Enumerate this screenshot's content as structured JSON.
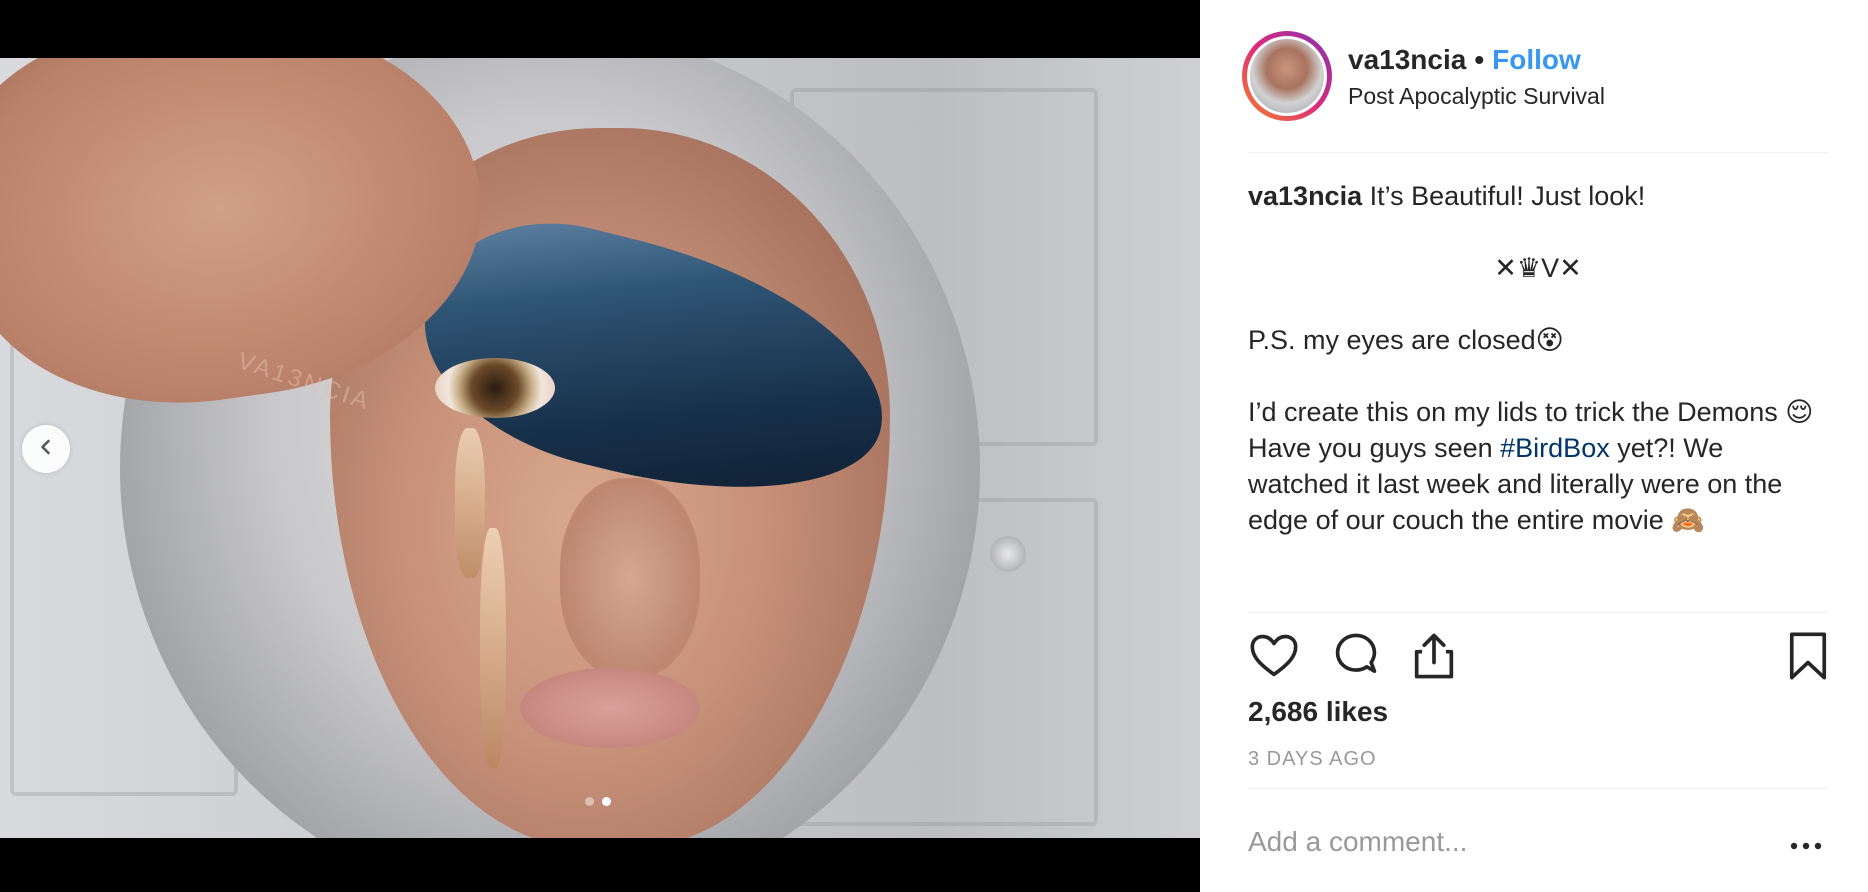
{
  "post": {
    "username": "va13ncia",
    "separator": "•",
    "follow_label": "Follow",
    "location": "Post Apocalyptic Survival",
    "watermark": "VA13NCIA"
  },
  "caption": {
    "username": "va13ncia",
    "line1": "It’s Beautiful! Just look!",
    "line2": "✕♛V✕",
    "line3": "P.S. my eyes are closed😵",
    "line4": "I’d create this on my lids to trick the Demons 😌",
    "line5_pre": "Have you guys seen ",
    "hashtag": "#BirdBox",
    "line5_post": " yet?! We watched it last week and literally were on the edge of our couch the entire movie 🙈"
  },
  "stats": {
    "likes": "2,686 likes",
    "time": "3 DAYS AGO"
  },
  "comment": {
    "placeholder": "Add a comment..."
  },
  "carousel": {
    "total": 2,
    "active_index": 2
  },
  "icons": {
    "prev": "chevron-left-icon",
    "like": "heart-icon",
    "comment": "comment-icon",
    "share": "share-icon",
    "save": "bookmark-icon",
    "more": "more-icon"
  },
  "colors": {
    "link": "#3897f0",
    "hashtag": "#003569",
    "muted": "#999999",
    "text": "#262626"
  }
}
